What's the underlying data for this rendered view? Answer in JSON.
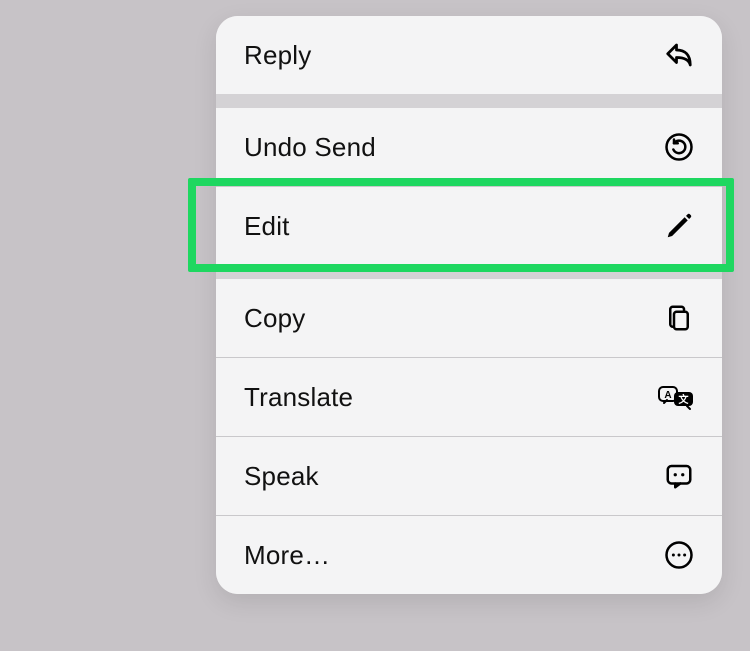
{
  "menu": {
    "items": [
      {
        "label": "Reply",
        "icon": "reply-icon"
      },
      {
        "label": "Undo Send",
        "icon": "undo-icon"
      },
      {
        "label": "Edit",
        "icon": "pencil-icon"
      },
      {
        "label": "Copy",
        "icon": "copy-icon"
      },
      {
        "label": "Translate",
        "icon": "translate-icon"
      },
      {
        "label": "Speak",
        "icon": "speak-icon"
      },
      {
        "label": "More…",
        "icon": "more-icon"
      }
    ]
  },
  "highlight": {
    "target_label": "Edit",
    "color": "#1ed760"
  }
}
